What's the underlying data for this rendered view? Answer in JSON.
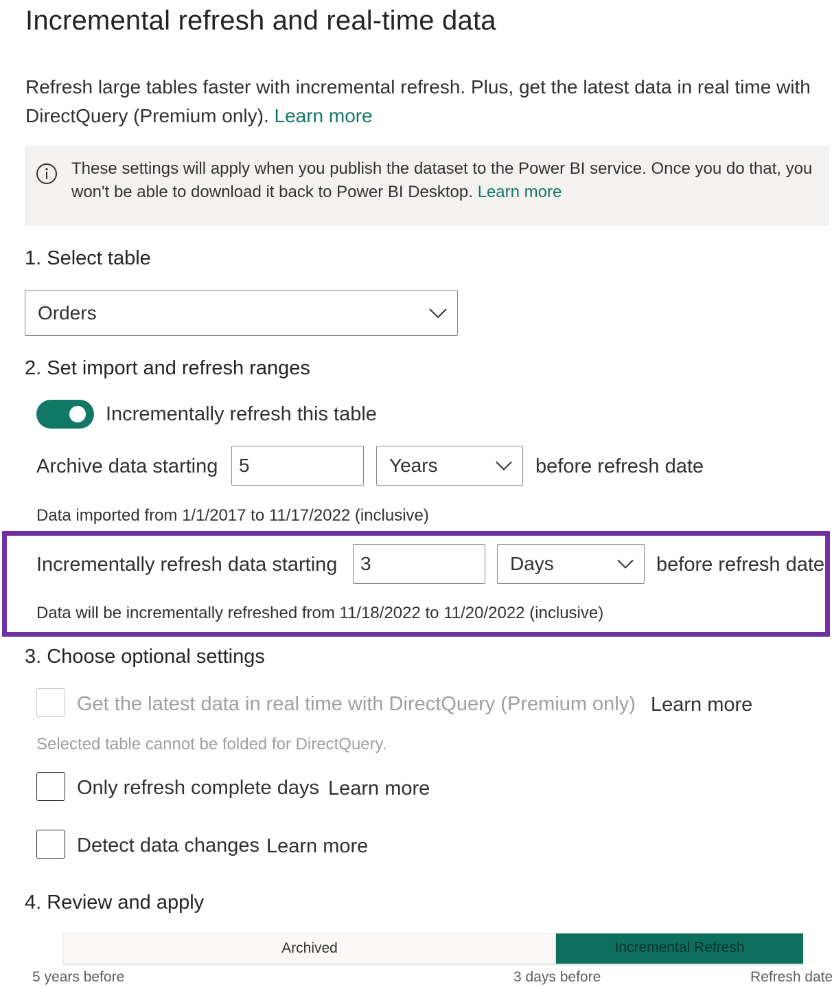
{
  "title": "Incremental refresh and real-time data",
  "intro": {
    "text": "Refresh large tables faster with incremental refresh. Plus, get the latest data in real time with DirectQuery (Premium only).",
    "link": "Learn more"
  },
  "banner": {
    "icon": "info-icon",
    "text": "These settings will apply when you publish the dataset to the Power BI service. Once you do that, you won't be able to download it back to Power BI Desktop.",
    "link": "Learn more"
  },
  "step1": {
    "heading": "1. Select table",
    "table_value": "Orders"
  },
  "step2": {
    "heading": "2. Set import and refresh ranges",
    "toggle_label": "Incrementally refresh this table",
    "toggle_on": true,
    "archive_label": "Archive data starting",
    "archive_value": "5",
    "archive_unit": "Years",
    "archive_suffix": "before refresh date",
    "archive_note": "Data imported from 1/1/2017 to 11/17/2022 (inclusive)",
    "incr_label": "Incrementally refresh data starting",
    "incr_value": "3",
    "incr_unit": "Days",
    "incr_suffix": "before refresh date",
    "incr_note": "Data will be incrementally refreshed from 11/18/2022 to 11/20/2022 (inclusive)",
    "highlight_color": "#7030a0"
  },
  "step3": {
    "heading": "3. Choose optional settings",
    "directquery_label": "Get the latest data in real time with DirectQuery (Premium only)",
    "directquery_link": "Learn more",
    "directquery_note": "Selected table cannot be folded for DirectQuery.",
    "complete_days_label": "Only refresh complete days",
    "complete_days_link": "Learn more",
    "detect_changes_label": "Detect data changes",
    "detect_changes_link": "Learn more"
  },
  "step4": {
    "heading": "4. Review and apply",
    "archived_label": "Archived",
    "incremental_label": "Incremental Refresh",
    "tick_start": "5 years before",
    "tick_mid": "3 days before",
    "tick_end": "Refresh date"
  },
  "colors": {
    "accent": "#117865",
    "incremental_segment": "#0f6f5d"
  }
}
